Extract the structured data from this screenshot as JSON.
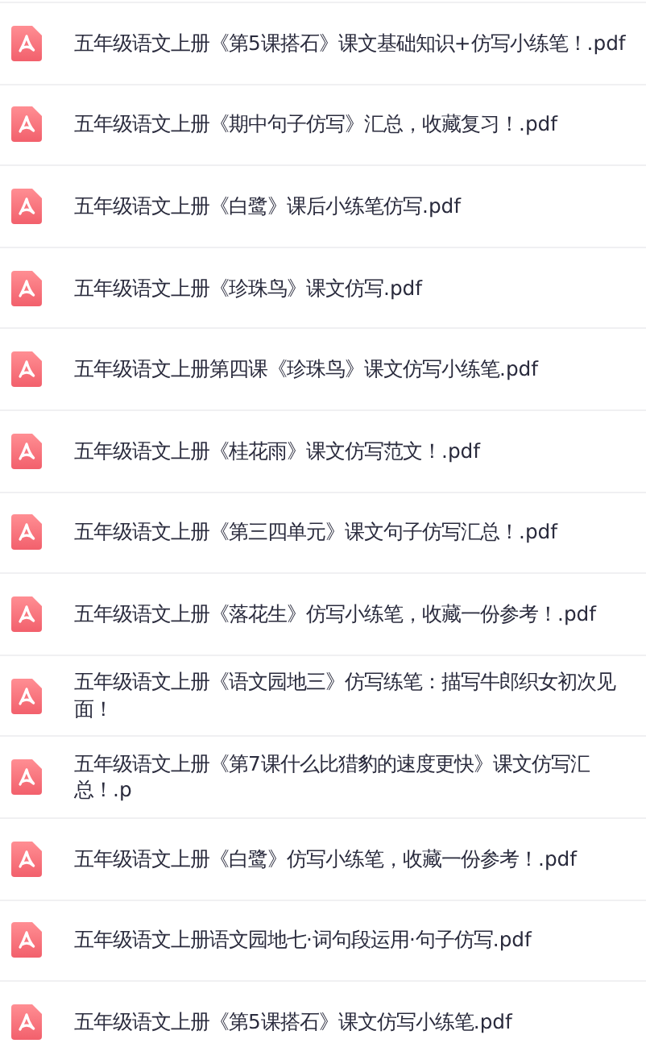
{
  "files": [
    {
      "name": "五年级语文上册《第5课搭石》课文基础知识+仿写小练笔！.pdf"
    },
    {
      "name": "五年级语文上册《期中句子仿写》汇总，收藏复习！.pdf"
    },
    {
      "name": "五年级语文上册《白鹭》课后小练笔仿写.pdf"
    },
    {
      "name": "五年级语文上册《珍珠鸟》课文仿写.pdf"
    },
    {
      "name": "五年级语文上册第四课《珍珠鸟》课文仿写小练笔.pdf"
    },
    {
      "name": "五年级语文上册《桂花雨》课文仿写范文！.pdf"
    },
    {
      "name": "五年级语文上册《第三四单元》课文句子仿写汇总！.pdf"
    },
    {
      "name": "五年级语文上册《落花生》仿写小练笔，收藏一份参考！.pdf"
    },
    {
      "name": "五年级语文上册《语文园地三》仿写练笔：描写牛郎织女初次见面！"
    },
    {
      "name": "五年级语文上册《第7课什么比猎豹的速度更快》课文仿写汇总！.p"
    },
    {
      "name": "五年级语文上册《白鹭》仿写小练笔，收藏一份参考！.pdf"
    },
    {
      "name": "五年级语文上册语文园地七·词句段运用·句子仿写.pdf"
    },
    {
      "name": "五年级语文上册《第5课搭石》课文仿写小练笔.pdf"
    }
  ]
}
